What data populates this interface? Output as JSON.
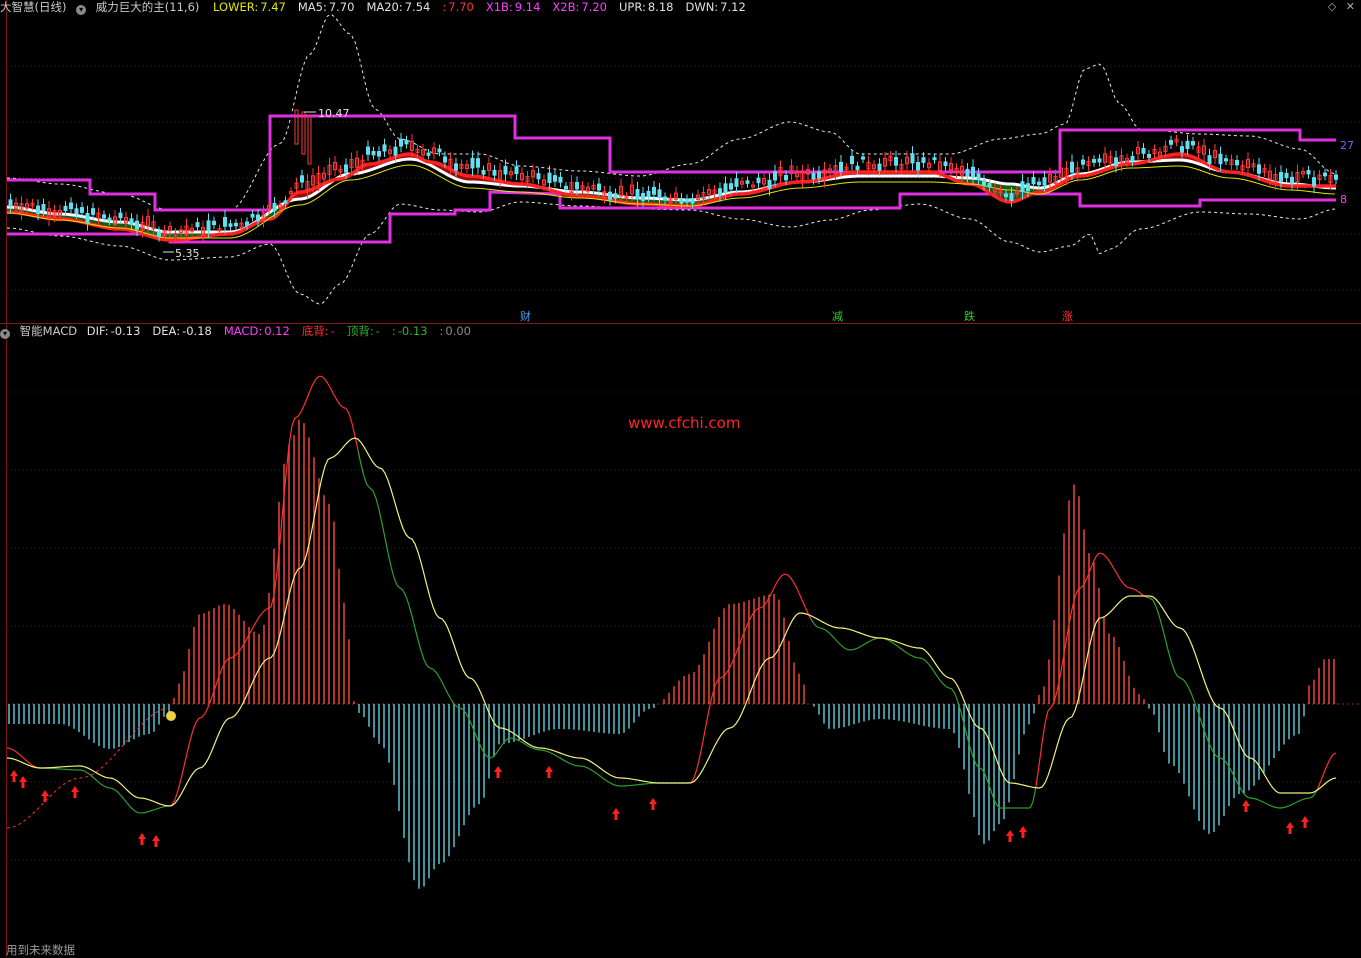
{
  "header": {
    "title": "大智慧(日线)",
    "indicator_name": "威力巨大的主(11,6)",
    "items": [
      {
        "label": "LOWER:",
        "value": "7.47",
        "color": "#e6e600"
      },
      {
        "label": "MA5:",
        "value": "7.70",
        "color": "#e0e0e0"
      },
      {
        "label": "MA20:",
        "value": "7.54",
        "color": "#e0e0e0"
      },
      {
        "label": ":",
        "value": "7.70",
        "color": "#ff3030"
      },
      {
        "label": "X1B:",
        "value": "9.14",
        "color": "#ff40ff"
      },
      {
        "label": "X2B:",
        "value": "7.20",
        "color": "#ff40ff"
      },
      {
        "label": "UPR:",
        "value": "8.18",
        "color": "#e0e0e0"
      },
      {
        "label": "DWN:",
        "value": "7.12",
        "color": "#e0e0e0"
      }
    ]
  },
  "price_pane": {
    "high_label": "10.47",
    "low_label": "5.35",
    "right_top": "27",
    "right_bottom": "8",
    "markers": [
      {
        "text": "财",
        "color": "#3aa0ff"
      },
      {
        "text": "减",
        "color": "#30d030"
      },
      {
        "text": "跌",
        "color": "#30d030"
      },
      {
        "text": "涨",
        "color": "#ff3030"
      }
    ]
  },
  "macd_header": {
    "name": "智能MACD",
    "items": [
      {
        "label": "DIF:",
        "value": "-0.13",
        "color": "#e0e0e0"
      },
      {
        "label": "DEA:",
        "value": "-0.18",
        "color": "#e0e0e0"
      },
      {
        "label": "MACD:",
        "value": "0.12",
        "color": "#ff40ff"
      },
      {
        "label": "底背:",
        "value": "-",
        "color": "#ff3030"
      },
      {
        "label": "顶背:",
        "value": "-",
        "color": "#30b030"
      },
      {
        "label": ":",
        "value": "-0.13",
        "color": "#30b030"
      },
      {
        "label": ":",
        "value": "0.00",
        "color": "#8a8a8a"
      }
    ]
  },
  "watermark": "www.cfchi.com",
  "footer": "用到未来数据",
  "colors": {
    "up_bar": "#ff4a3a",
    "down_bar": "#5fd0e0",
    "channel": "#e030e0",
    "grid": "#6a1010"
  }
}
